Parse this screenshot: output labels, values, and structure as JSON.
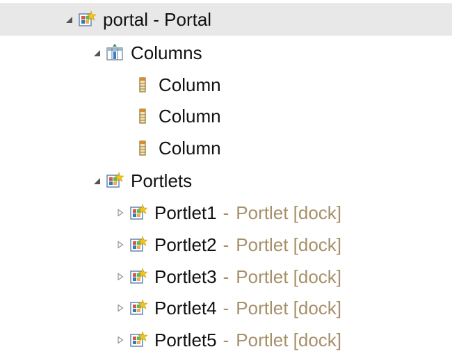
{
  "tree": {
    "root": {
      "label": "portal - Portal",
      "expanded": true,
      "icon": "portal-icon"
    },
    "columns": {
      "label": "Columns",
      "expanded": true,
      "icon": "columns-icon",
      "items": [
        {
          "label": "Column",
          "icon": "column-icon"
        },
        {
          "label": "Column",
          "icon": "column-icon"
        },
        {
          "label": "Column",
          "icon": "column-icon"
        }
      ]
    },
    "portlets": {
      "label": "Portlets",
      "expanded": true,
      "icon": "portlets-icon",
      "items": [
        {
          "name": "Portlet1",
          "separator": "-",
          "type": "Portlet [dock]",
          "expanded": false,
          "icon": "portlet-icon"
        },
        {
          "name": "Portlet2",
          "separator": "-",
          "type": "Portlet [dock]",
          "expanded": false,
          "icon": "portlet-icon"
        },
        {
          "name": "Portlet3",
          "separator": "-",
          "type": "Portlet [dock]",
          "expanded": false,
          "icon": "portlet-icon"
        },
        {
          "name": "Portlet4",
          "separator": "-",
          "type": "Portlet [dock]",
          "expanded": false,
          "icon": "portlet-icon"
        },
        {
          "name": "Portlet5",
          "separator": "-",
          "type": "Portlet [dock]",
          "expanded": false,
          "icon": "portlet-icon"
        }
      ]
    }
  },
  "colors": {
    "selection_background": "#e8e8e8",
    "label_text": "#111111",
    "decoration_text": "#a5906a"
  }
}
